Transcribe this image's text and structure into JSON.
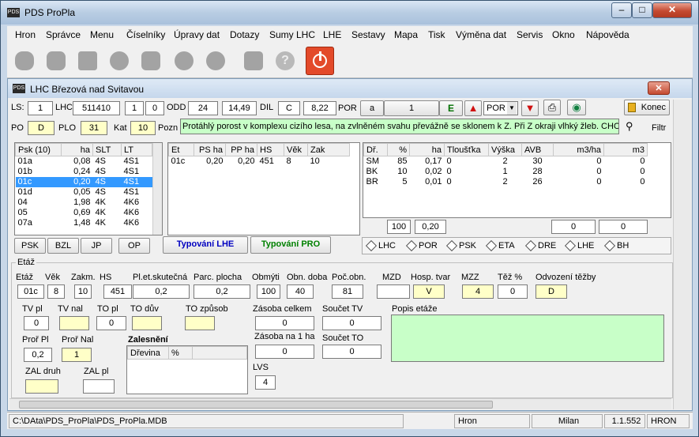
{
  "window": {
    "title": "PDS ProPla",
    "icon": "PDS"
  },
  "menu": [
    "Hron",
    "Správce",
    "Menu",
    "Číselníky",
    "Úpravy dat",
    "Dotazy",
    "Sumy LHC",
    "LHE",
    "Sestavy",
    "Mapa",
    "Tisk",
    "Výměna dat",
    "Servis",
    "Okno",
    "Nápověda"
  ],
  "child": {
    "title": "LHC Březová nad Svitavou",
    "row1": {
      "ls_label": "LS:",
      "ls": "1",
      "lhc_label": "LHC",
      "lhc": "511410",
      "f1": "1",
      "f2": "0",
      "odd_label": "ODD",
      "odd": "24",
      "area": "14,49",
      "dil_label": "DIL",
      "dil": "C",
      "dil_area": "8,22",
      "por_label": "POR",
      "por": "a",
      "por_num": "1",
      "e_label": "E",
      "combo": "POR",
      "konec": "Konec"
    },
    "row2": {
      "po_label": "PO",
      "po": "D",
      "plo_label": "PLO",
      "plo": "31",
      "kat_label": "Kat",
      "kat": "10",
      "pozn_label": "Pozn",
      "pozn": "Protáhlý porost v komplexu cizího lesa, na zvlněném svahu převážně se sklonem k Z. Při Z okraji vlhký žleb. CHOPA",
      "filtr": "Filtr"
    },
    "psk_grid": {
      "headers": [
        "Psk (10)",
        "ha",
        "SLT",
        "LT"
      ],
      "rows": [
        [
          "01a",
          "0,08",
          "4S",
          "4S1"
        ],
        [
          "01b",
          "0,24",
          "4S",
          "4S1"
        ],
        [
          "01c",
          "0,20",
          "4S",
          "4S1"
        ],
        [
          "01d",
          "0,05",
          "4S",
          "4S1"
        ],
        [
          "04",
          "1,98",
          "4K",
          "4K6"
        ],
        [
          "05",
          "0,69",
          "4K",
          "4K6"
        ],
        [
          "07a",
          "1,48",
          "4K",
          "4K6"
        ]
      ],
      "selected": 2
    },
    "et_grid": {
      "headers": [
        "Et",
        "PS ha",
        "PP ha",
        "HS",
        "Věk",
        "Zak"
      ],
      "rows": [
        [
          "01c",
          "0,20",
          "0,20",
          "451",
          "8",
          "10"
        ]
      ]
    },
    "dr_grid": {
      "headers": [
        "Dř.",
        "%",
        "ha",
        "Tloušťka",
        "Výška",
        "AVB",
        "m3/ha",
        "m3"
      ],
      "rows": [
        [
          "SM",
          "85",
          "0,17",
          "0",
          "2",
          "30",
          "0",
          "0"
        ],
        [
          "BK",
          "10",
          "0,02",
          "0",
          "1",
          "28",
          "0",
          "0"
        ],
        [
          "BR",
          "5",
          "0,01",
          "0",
          "2",
          "26",
          "0",
          "0"
        ]
      ],
      "sum_pct": "100",
      "sum_ha": "0,20",
      "sum_m3ha": "0",
      "sum_m3": "0"
    },
    "tabs": [
      "PSK",
      "BZL",
      "JP",
      "OP"
    ],
    "typ_lhe": "Typování LHE",
    "typ_pro": "Typování PRO",
    "levels": [
      "LHC",
      "POR",
      "PSK",
      "ETA",
      "DRE",
      "LHE",
      "BH"
    ],
    "etaz": {
      "group": "Etáž",
      "labels": [
        "Etáž",
        "Věk",
        "Zakm.",
        "HS",
        "Pl.et.skutečná",
        "Parc. plocha",
        "Obmýti",
        "Obn. doba",
        "Poč.obn.",
        "MZD",
        "Hosp. tvar",
        "MZZ",
        "Těž %",
        "Odvození těžby"
      ],
      "values": [
        "01c",
        "8",
        "10",
        "451",
        "0,2",
        "0,2",
        "100",
        "40",
        "81",
        "",
        "V",
        "4",
        "0",
        "D"
      ],
      "tv_pl_label": "TV pl",
      "tv_pl": "0",
      "tv_nal_label": "TV nal",
      "tv_nal": "",
      "to_pl_label": "TO pl",
      "to_pl": "0",
      "to_duv_label": "TO dův",
      "to_duv": "",
      "to_zpusob_label": "TO způsob",
      "to_zpusob": "",
      "zasoba_celkem_label": "Zásoba celkem",
      "zasoba_celkem": "0",
      "soucet_tv_label": "Součet TV",
      "soucet_tv": "0",
      "zasoba_ha_label": "Zásoba na 1 ha",
      "zasoba_ha": "0",
      "soucet_to_label": "Součet TO",
      "soucet_to": "0",
      "lvs_label": "LVS",
      "lvs": "4",
      "popis_label": "Popis etáže",
      "prof_pl_label": "Proř Pl",
      "prof_pl": "0,2",
      "prof_nal_label": "Proř Nal",
      "prof_nal": "1",
      "zal_druh_label": "ZAL druh",
      "zal_druh": "",
      "zal_pl_label": "ZAL pl",
      "zal_pl": "",
      "zalesneni_label": "Zalesnění",
      "zalesneni_headers": [
        "Dřevina",
        "%"
      ]
    }
  },
  "status": {
    "path": "C:\\DAta\\PDS_ProPla\\PDS_ProPla.MDB",
    "cell1": "Hron",
    "cell2": "Milan",
    "cell3": "1.1.552",
    "cell4": "HRON"
  },
  "colors": {
    "selection": "#3399ff",
    "note_bg": "#c8ffc8",
    "yellow_field": "#ffffc8",
    "popis_bg": "#c8ffc8",
    "typ_lhe": "#0000c0",
    "typ_pro": "#008000"
  }
}
